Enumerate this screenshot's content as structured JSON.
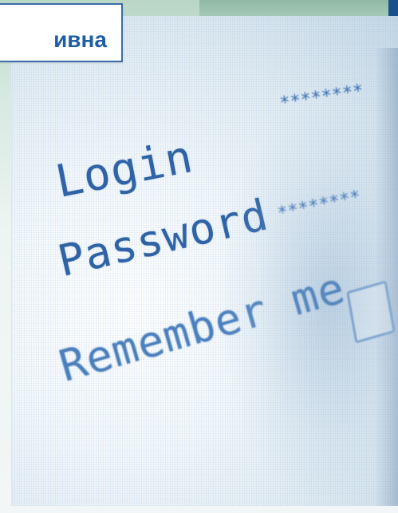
{
  "title": {
    "text": "ивна"
  },
  "form": {
    "login_label": "Login",
    "password_label": "Password",
    "remember_label": "Remember me",
    "login_value": "********",
    "password_value": "********"
  },
  "colors": {
    "accent": "#1f5ea3",
    "text_blue": "#2f63a6",
    "banner_green": "#8fb9a5",
    "corner_blue": "#1a4f8c"
  }
}
